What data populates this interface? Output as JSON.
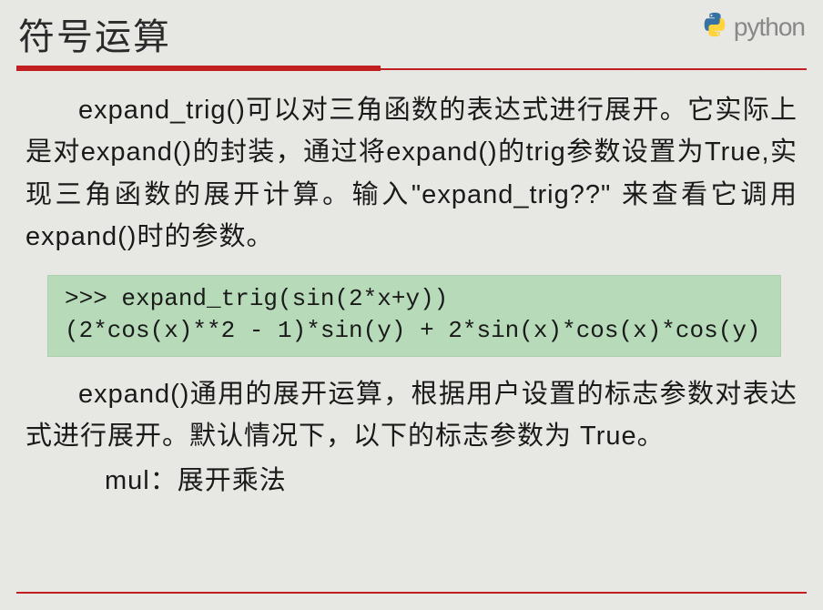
{
  "header": {
    "title": "符号运算",
    "brand": "python"
  },
  "para1": "expand_trig()可以对三角函数的表达式进行展开。它实际上是对expand()的封装，通过将expand()的trig参数设置为True,实现三角函数的展开计算。输入\"expand_trig??\" 来查看它调用expand()时的参数。",
  "code": {
    "line1": ">>> expand_trig(sin(2*x+y))",
    "line2": "(2*cos(x)**2 - 1)*sin(y) + 2*sin(x)*cos(x)*cos(y)"
  },
  "para2": "expand()通用的展开运算，根据用户设置的标志参数对表达式进行展开。默认情况下，以下的标志参数为 True。",
  "para3": "mul：展开乘法"
}
